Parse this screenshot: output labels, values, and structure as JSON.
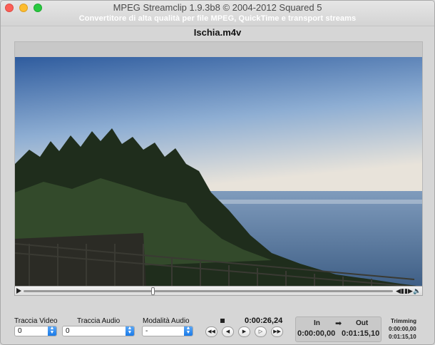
{
  "window": {
    "title": "MPEG Streamclip 1.9.3b8  ©  2004-2012 Squared 5",
    "subtitle": "Convertitore di alta qualità per file MPEG, QuickTime e transport streams"
  },
  "file": {
    "name": "Ischia.m4v"
  },
  "controls": {
    "video_track": {
      "label": "Traccia Video",
      "value": "0"
    },
    "audio_track": {
      "label": "Traccia Audio",
      "value": "0"
    },
    "audio_mode": {
      "label": "Modalità Audio",
      "value": "-"
    },
    "current_time": "0:00:26,24",
    "scrub_position": 0.35,
    "transport_icons": [
      "rewind-icon",
      "step-back-icon",
      "play-icon",
      "play-outline-icon",
      "fast-forward-icon"
    ]
  },
  "inout": {
    "in_label": "In",
    "out_label": "Out",
    "arrow": "➡",
    "in_value": "0:00:00,00",
    "out_value": "0:01:15,10"
  },
  "trimming": {
    "label": "Trimming",
    "start": "0:00:00,00",
    "end": "0:01:15,10"
  },
  "colors": {
    "select_accent": "#1a7ae8",
    "close": "#fc5f57",
    "minimize": "#fdbc2e",
    "maximize": "#28c940"
  }
}
